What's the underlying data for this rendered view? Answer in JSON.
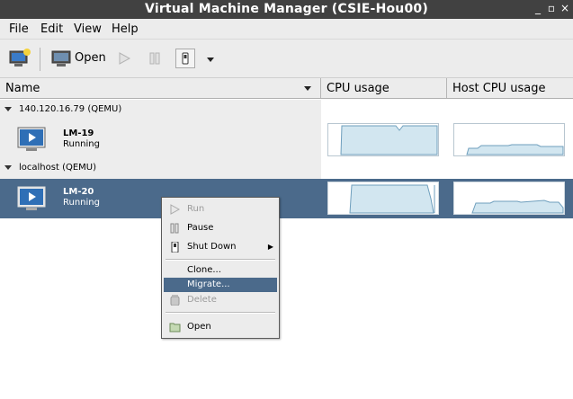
{
  "window": {
    "title": "Virtual Machine Manager (CSIE-Hou00)",
    "controls": {
      "minimize": "_",
      "maximize": "▫",
      "close": "×"
    }
  },
  "menubar": {
    "items": [
      "File",
      "Edit",
      "View",
      "Help"
    ]
  },
  "toolbar": {
    "new_icon": "new-vm-icon",
    "open_label": "Open",
    "run_icon": "play-icon",
    "pause_icon": "pause-icon",
    "shutdown_icon": "power-icon",
    "dropdown_icon": "chevron-down-icon"
  },
  "columns": {
    "name": "Name",
    "cpu": "CPU usage",
    "host_cpu": "Host CPU usage"
  },
  "groups": [
    {
      "label": "140.120.16.79 (QEMU)",
      "vms": [
        {
          "name": "LM-19",
          "status": "Running"
        }
      ]
    },
    {
      "label": "localhost (QEMU)",
      "vms": [
        {
          "name": "LM-20",
          "status": "Running",
          "selected": true
        }
      ]
    }
  ],
  "context_menu": {
    "items": [
      {
        "label": "Run",
        "enabled": false,
        "icon": "play-icon"
      },
      {
        "label": "Pause",
        "enabled": true,
        "icon": "pause-icon"
      },
      {
        "label": "Shut Down",
        "enabled": true,
        "icon": "power-icon",
        "submenu": true
      },
      {
        "label": "Clone...",
        "enabled": true
      },
      {
        "label": "Migrate...",
        "enabled": true,
        "highlighted": true
      },
      {
        "label": "Delete",
        "enabled": false,
        "icon": "trash-icon"
      },
      {
        "label": "Open",
        "enabled": true,
        "icon": "folder-icon"
      }
    ]
  },
  "colors": {
    "selection": "#4b6a8b",
    "graph_fill": "#d2e6f0",
    "graph_line": "#6f9fbd",
    "titlebar": "#414141"
  }
}
